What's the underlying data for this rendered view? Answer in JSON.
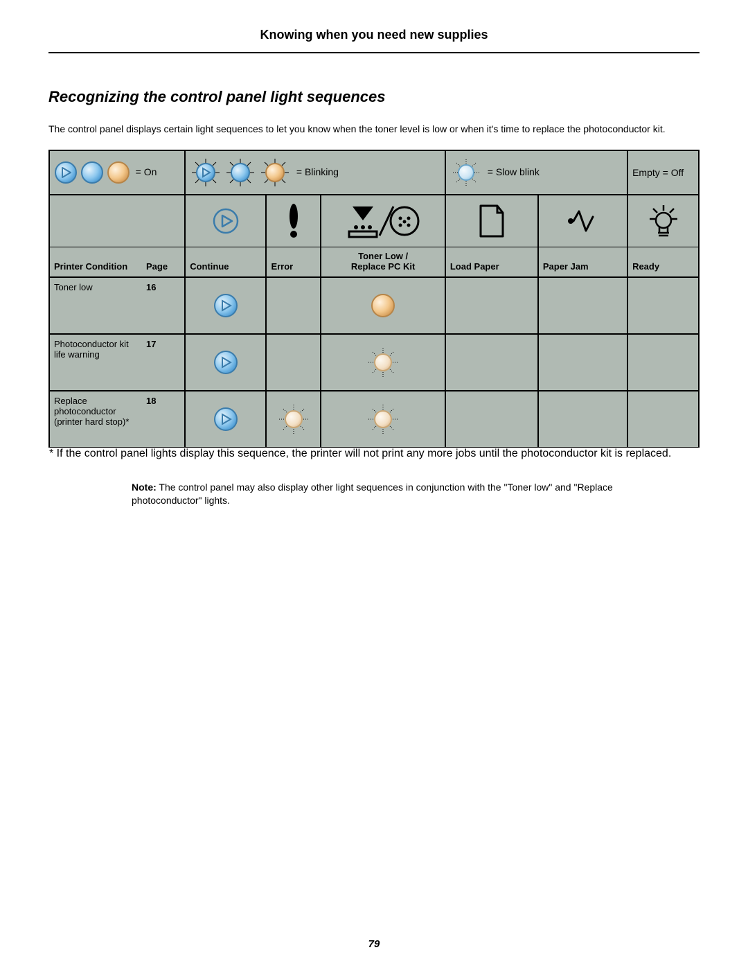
{
  "header": "Knowing when you need new supplies",
  "section": "Recognizing the control panel light sequences",
  "intro": "The control panel displays certain light sequences to let you know when the toner level is low or when it's time to replace the photoconductor kit.",
  "legend": {
    "on": "= On",
    "blink": "= Blinking",
    "slow": "= Slow blink",
    "empty": "Empty = Off"
  },
  "cols": {
    "condition": "Printer Condition",
    "page": "Page",
    "continue": "Continue",
    "error": "Error",
    "toner": "Toner Low / Replace PC Kit",
    "tonerL1": "Toner Low /",
    "tonerL2": "Replace PC Kit",
    "load": "Load Paper",
    "jam": "Paper Jam",
    "ready": "Ready"
  },
  "rows": [
    {
      "condition": "Toner low",
      "page": "16",
      "continue": "on-blue",
      "error": "",
      "toner": "on-orange",
      "load": "",
      "jam": "",
      "ready": ""
    },
    {
      "condition": "Photoconductor kit life warning",
      "page": "17",
      "continue": "on-blue",
      "error": "",
      "toner": "blink-orange",
      "load": "",
      "jam": "",
      "ready": ""
    },
    {
      "condition": "Replace photoconductor (printer hard stop)*",
      "page": "18",
      "continue": "on-blue",
      "error": "blink-orange",
      "toner": "blink-orange",
      "load": "",
      "jam": "",
      "ready": ""
    }
  ],
  "footnote": "* If the control panel lights display this sequence, the printer will not print any more jobs until the photoconductor kit is replaced.",
  "noteLabel": "Note:",
  "noteText": " The control panel may also display other light sequences in conjunction with the \"Toner low\" and \"Replace photoconductor\" lights.",
  "pageNumber": "79"
}
